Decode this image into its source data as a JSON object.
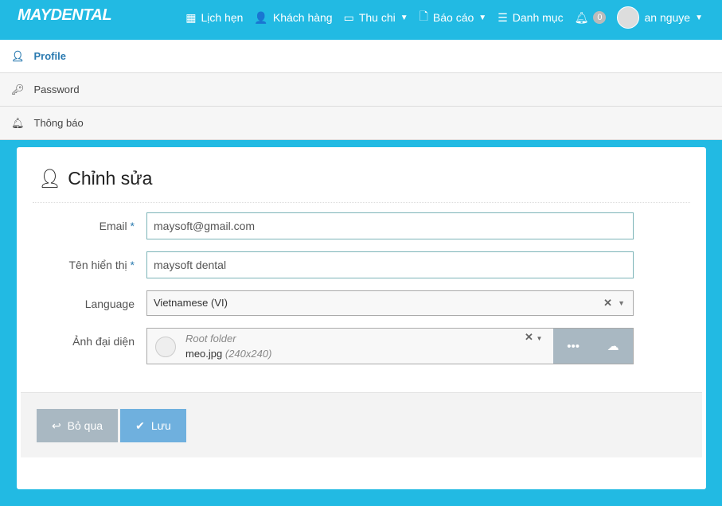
{
  "header": {
    "logo": "MAYDENTAL",
    "nav": [
      {
        "label": "Lịch hẹn",
        "icon": "calendar-icon"
      },
      {
        "label": "Khách hàng",
        "icon": "user-doctor-icon"
      },
      {
        "label": "Thu chi",
        "icon": "money-icon",
        "dropdown": true
      },
      {
        "label": "Báo cáo",
        "icon": "file-icon",
        "dropdown": true
      },
      {
        "label": "Danh mục",
        "icon": "database-icon"
      }
    ],
    "notifications": "0",
    "user": "an nguye"
  },
  "sidebar": {
    "items": [
      {
        "label": "Profile",
        "icon": "user-icon",
        "active": true
      },
      {
        "label": "Password",
        "icon": "key-icon"
      },
      {
        "label": "Thông báo",
        "icon": "bell-icon"
      }
    ]
  },
  "form": {
    "title": "Chỉnh sửa",
    "email_label": "Email",
    "email": "maysoft@gmail.com",
    "name_label": "Tên hiển thị",
    "name": "maysoft dental",
    "required": "*",
    "language_label": "Language",
    "language": "Vietnamese (VI)",
    "avatar_label": "Ảnh đại diện",
    "folder": "Root folder",
    "file": "meo.jpg",
    "dims": "(240x240)"
  },
  "buttons": {
    "cancel": "Bỏ qua",
    "save": "Lưu"
  },
  "colors": {
    "header": "#22bae3",
    "save": "#6fb0de",
    "cancel": "#a9b8c2"
  }
}
